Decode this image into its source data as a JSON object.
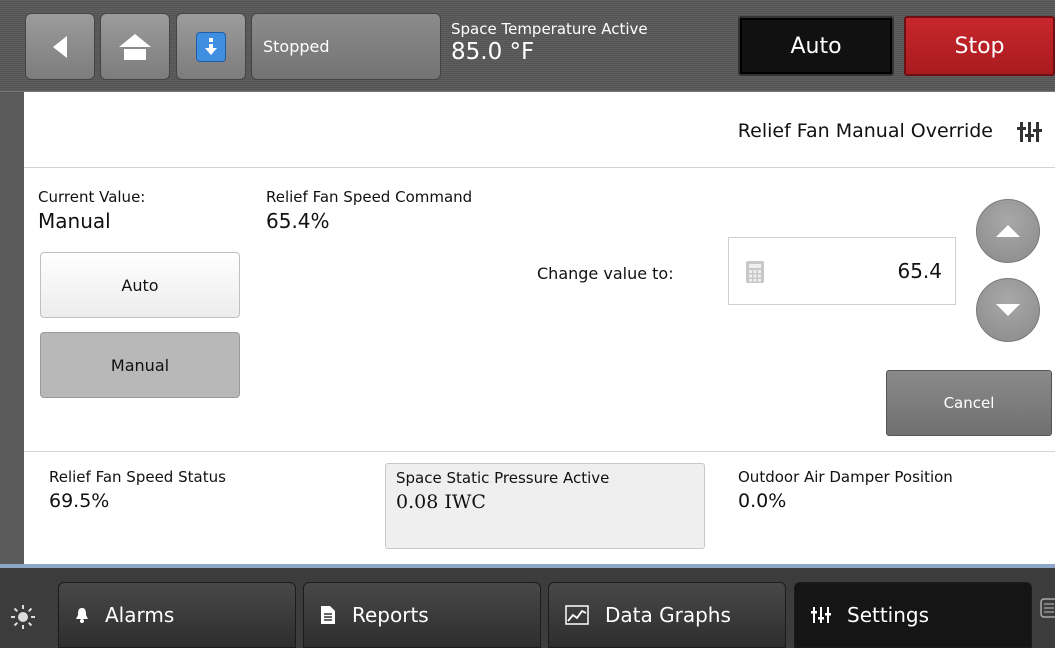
{
  "header": {
    "status": "Stopped",
    "space_temp_label": "Space Temperature Active",
    "space_temp_value": "85.0 °F",
    "auto_button": "Auto",
    "stop_button": "Stop"
  },
  "override": {
    "title": "Relief Fan Manual Override",
    "current_value_label": "Current Value:",
    "current_value": "Manual",
    "command_label": "Relief Fan Speed Command",
    "command_value": "65.4%",
    "auto_button": "Auto",
    "manual_button": "Manual",
    "change_label": "Change value to:",
    "input_value": "65.4",
    "cancel_button": "Cancel"
  },
  "stats": [
    {
      "label": "Relief Fan Speed Status",
      "value": "69.5%"
    },
    {
      "label": "Space Static Pressure Active",
      "value": "0.08 IWC"
    },
    {
      "label": "Outdoor Air Damper Position",
      "value": "0.0%"
    }
  ],
  "tabs": [
    {
      "label": "Alarms",
      "icon": "bell-icon"
    },
    {
      "label": "Reports",
      "icon": "document-icon"
    },
    {
      "label": "Data Graphs",
      "icon": "graph-icon"
    },
    {
      "label": "Settings",
      "icon": "sliders-icon"
    }
  ],
  "colors": {
    "stop": "#b41f24",
    "selected": "#b8b8b8",
    "accent_blue": "#3f8ee0"
  }
}
